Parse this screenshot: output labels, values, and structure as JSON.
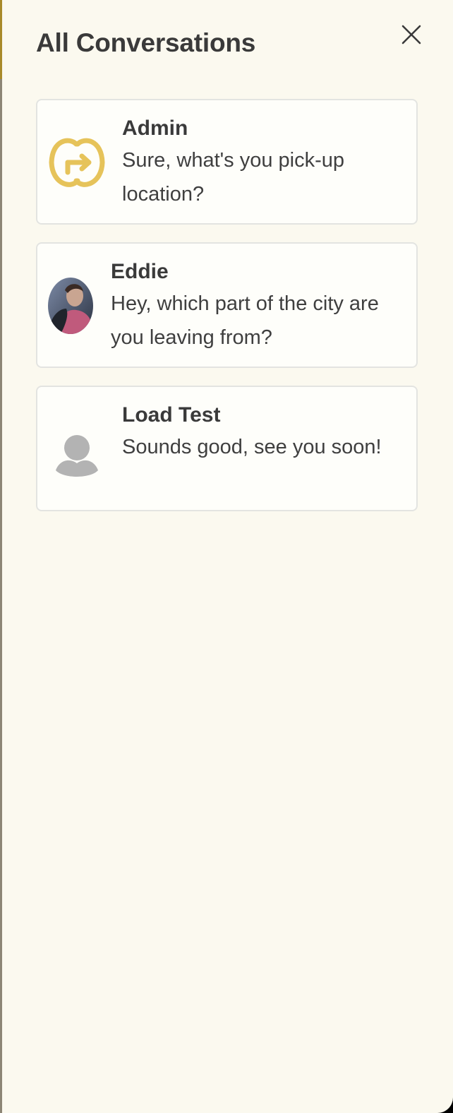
{
  "header": {
    "title": "All Conversations"
  },
  "icons": {
    "close": "close-icon",
    "admin_avatar": "go-logo-icon",
    "eddie_avatar": "user-photo",
    "load_test_avatar": "default-user-icon"
  },
  "colors": {
    "background": "#fbf9ef",
    "card_background": "#fefefa",
    "card_border": "#e3e4e1",
    "logo_gold": "#e6c35a",
    "placeholder_gray": "#b3b3b3"
  },
  "conversations": [
    {
      "name": "Admin",
      "message": "Sure, what's you pick-up location?"
    },
    {
      "name": "Eddie",
      "message": "Hey, which part of the city are you leaving from?"
    },
    {
      "name": "Load Test",
      "message": "Sounds good, see you soon!"
    }
  ]
}
